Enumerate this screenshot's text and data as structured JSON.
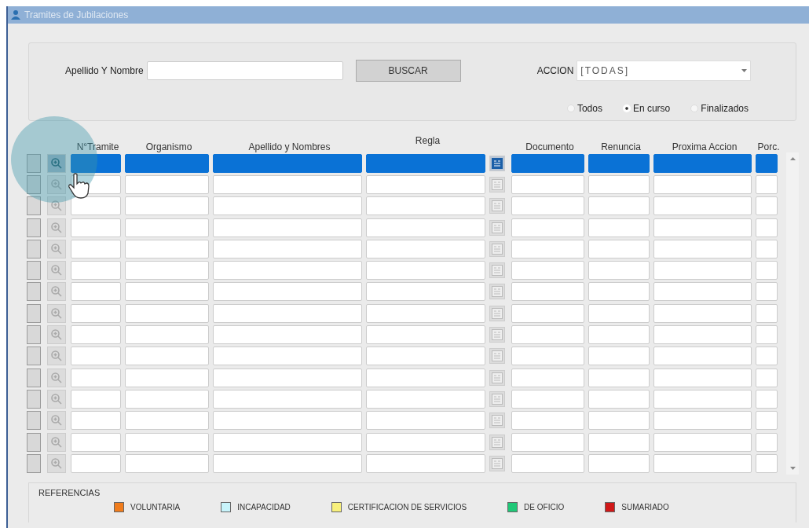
{
  "window": {
    "title": "Tramites de Jubilaciones"
  },
  "search": {
    "label": "Apellido Y Nombre",
    "button": "BUSCAR"
  },
  "accion": {
    "label": "ACCION",
    "value": "[TODAS]"
  },
  "filters": [
    {
      "label": "Todos",
      "selected": false
    },
    {
      "label": "En curso",
      "selected": true
    },
    {
      "label": "Finalizados",
      "selected": false
    }
  ],
  "table": {
    "columns": [
      "N°Tramite",
      "Organismo",
      "Apellido y Nombres",
      "Regla",
      "Documento",
      "Renuncia",
      "Proxima Accion",
      "Porc."
    ],
    "rows": [
      {
        "selected": true
      },
      {
        "selected": false
      },
      {
        "selected": false
      },
      {
        "selected": false
      },
      {
        "selected": false
      },
      {
        "selected": false
      },
      {
        "selected": false
      },
      {
        "selected": false
      },
      {
        "selected": false
      },
      {
        "selected": false
      },
      {
        "selected": false
      },
      {
        "selected": false
      },
      {
        "selected": false
      },
      {
        "selected": false
      },
      {
        "selected": false
      }
    ]
  },
  "references": {
    "title": "REFERENCIAS",
    "items": [
      {
        "label": "VOLUNTARIA",
        "color": "#f07c1c"
      },
      {
        "label": "INCAPACIDAD",
        "color": "#c8f4fb"
      },
      {
        "label": "CERTIFICACION DE SERVICIOS",
        "color": "#f8f07c"
      },
      {
        "label": "DE OFICIO",
        "color": "#20c878"
      },
      {
        "label": "SUMARIADO",
        "color": "#d01818"
      }
    ]
  }
}
